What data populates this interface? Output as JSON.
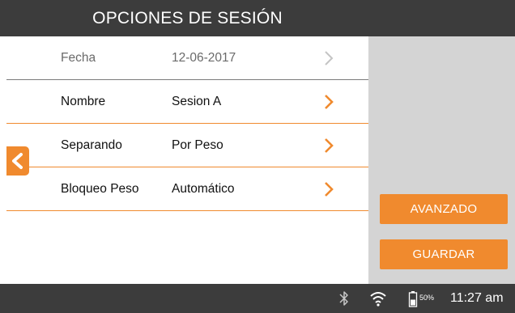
{
  "header": {
    "title": "OPCIONES DE SESIÓN"
  },
  "settings": {
    "rows": [
      {
        "label": "Fecha",
        "value": "12-06-2017",
        "enabled": false
      },
      {
        "label": "Nombre",
        "value": "Sesion A",
        "enabled": true
      },
      {
        "label": "Separando",
        "value": "Por Peso",
        "enabled": true
      },
      {
        "label": "Bloqueo Peso",
        "value": "Automático",
        "enabled": true
      }
    ]
  },
  "actions": {
    "advanced_label": "AVANZADO",
    "save_label": "GUARDAR"
  },
  "status": {
    "battery_percent": "50%",
    "time": "11:27 am"
  },
  "icons": {
    "back": "chevron-left-icon",
    "row_chevron": "chevron-right-icon",
    "bluetooth": "bluetooth-icon",
    "wifi": "wifi-icon",
    "battery": "battery-icon"
  },
  "colors": {
    "accent": "#f08a2e",
    "bar": "#3c3c3c",
    "panel": "#d4d4d4",
    "disabled": "#7a7a7a"
  }
}
